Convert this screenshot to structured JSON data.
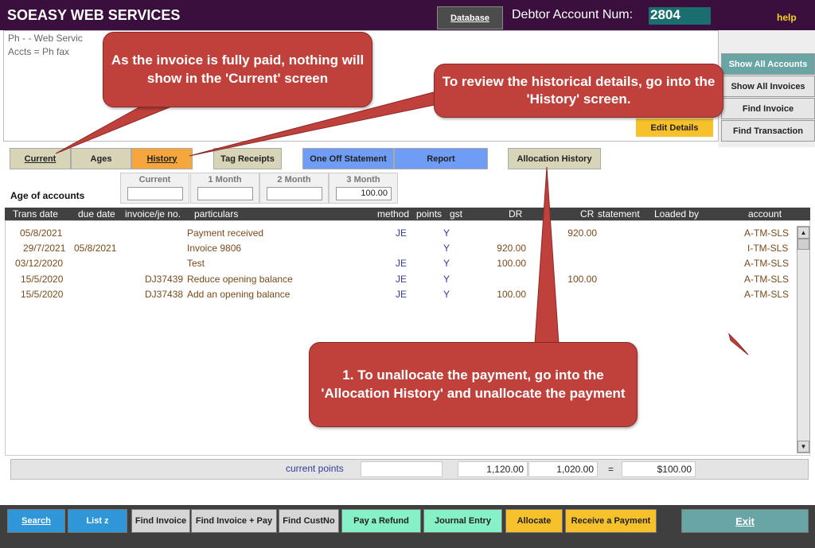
{
  "header": {
    "app_title": "SOEASY WEB SERVICES",
    "database_label": "Database",
    "debtor_label": "Debtor Account Num:",
    "debtor_num": "2804",
    "help_label": "help"
  },
  "info": {
    "line1": "Ph  - - Web Servic",
    "line2": "Accts =  Ph  fax",
    "edit_details": "Edit Details"
  },
  "sidebar": {
    "show_all_accounts": "Show All Accounts",
    "show_all_invoices": "Show All Invoices",
    "find_invoice": "Find Invoice",
    "find_transaction": "Find Transaction"
  },
  "tabs": {
    "current": "Current",
    "ages": "Ages",
    "history": "History",
    "tag_receipts": "Tag Receipts",
    "one_off_statement": "One Off Statement",
    "report": "Report",
    "allocation_history": "Allocation History"
  },
  "ages": {
    "label": "Age of accounts",
    "boxes": [
      {
        "label": "Current",
        "value": ""
      },
      {
        "label": "1 Month",
        "value": ""
      },
      {
        "label": "2 Month",
        "value": ""
      },
      {
        "label": "3 Month",
        "value": "100.00"
      }
    ]
  },
  "grid": {
    "headers": {
      "trans_date": "Trans date",
      "due_date": "due date",
      "invoice": "invoice/je no.",
      "particulars": "particulars",
      "method": "method",
      "points": "points",
      "gst": "gst",
      "dr": "DR",
      "cr": "CR",
      "statement": "statement",
      "loaded_by": "Loaded by",
      "account": "account"
    },
    "rows": [
      {
        "trans_date": "05/8/2021",
        "due_date": "",
        "invoice": "",
        "particulars": "Payment received",
        "method": "JE",
        "gst": "Y",
        "dr": "",
        "cr": "920.00",
        "account": "A-TM-SLS"
      },
      {
        "trans_date": "29/7/2021",
        "due_date": "05/8/2021",
        "invoice": "",
        "particulars": "Invoice 9806",
        "method": "",
        "gst": "Y",
        "dr": "920.00",
        "cr": "",
        "account": "I-TM-SLS"
      },
      {
        "trans_date": "03/12/2020",
        "due_date": "",
        "invoice": "",
        "particulars": "Test",
        "method": "JE",
        "gst": "Y",
        "dr": "100.00",
        "cr": "",
        "account": "A-TM-SLS"
      },
      {
        "trans_date": "15/5/2020",
        "due_date": "",
        "invoice": "DJ37439",
        "particulars": "Reduce opening balance",
        "method": "JE",
        "gst": "Y",
        "dr": "",
        "cr": "100.00",
        "account": "A-TM-SLS"
      },
      {
        "trans_date": "15/5/2020",
        "due_date": "",
        "invoice": "DJ37438",
        "particulars": "Add an opening balance",
        "method": "JE",
        "gst": "Y",
        "dr": "100.00",
        "cr": "",
        "account": "A-TM-SLS"
      }
    ]
  },
  "totals": {
    "current_points_label": "current points",
    "points_value": "",
    "dr_total": "1,120.00",
    "cr_total": "1,020.00",
    "equals": "=",
    "balance": "$100.00"
  },
  "bottom": {
    "search": "Search",
    "list": "List z",
    "find_invoice": "Find Invoice",
    "find_invoice_pay": "Find Invoice + Pay",
    "find_custno": "Find CustNo",
    "pay_refund": "Pay a Refund",
    "journal_entry": "Journal Entry",
    "allocate": "Allocate",
    "receive_payment": "Receive a Payment",
    "exit": "Exit"
  },
  "callouts": {
    "current": "As the invoice is fully paid, nothing will show in the 'Current' screen",
    "history": "To review the historical details, go into the 'History' screen.",
    "unallocate": "1. To unallocate the payment, go into the 'Allocation History' and unallocate the payment"
  },
  "colors": {
    "title_bar": "#3b0f3d",
    "callout": "#c0413b",
    "history_tab": "#f5a63c",
    "blue_tab": "#6f9cf5",
    "accent_teal": "#6aa5a5"
  }
}
